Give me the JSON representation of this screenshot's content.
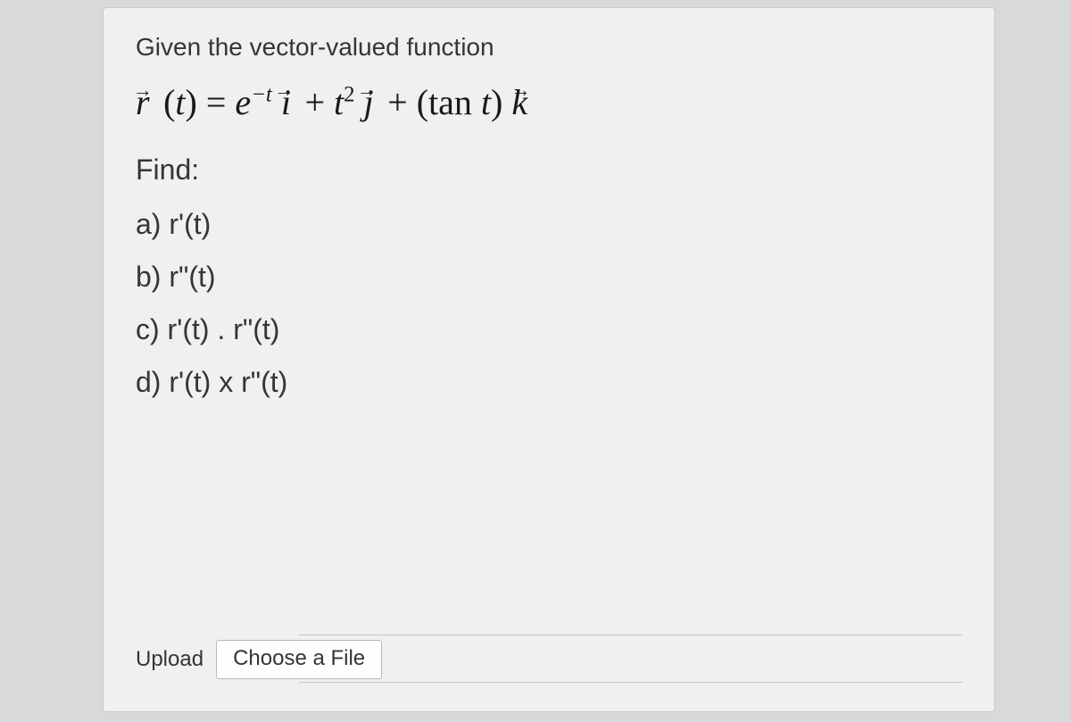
{
  "prompt": "Given the vector-valued function",
  "equation": {
    "r": "r",
    "t_open": "(",
    "t_var": "t",
    "t_close": ")",
    "eq": " = ",
    "e": "e",
    "sup_neg_t": "−t",
    "i": "i",
    "plus1": " + ",
    "t2_base": "t",
    "t2_sup": "2",
    "j": "j",
    "plus2": " + (tan ",
    "tan_t": "t",
    "close_paren": ") ",
    "k": "k"
  },
  "find_label": "Find:",
  "items": {
    "a": "a) r'(t)",
    "b": "b)  r\"(t)",
    "c": "c) r'(t) . r\"(t)",
    "d": "d)  r'(t) x r\"(t)"
  },
  "upload": {
    "label": "Upload",
    "button": "Choose a File"
  }
}
